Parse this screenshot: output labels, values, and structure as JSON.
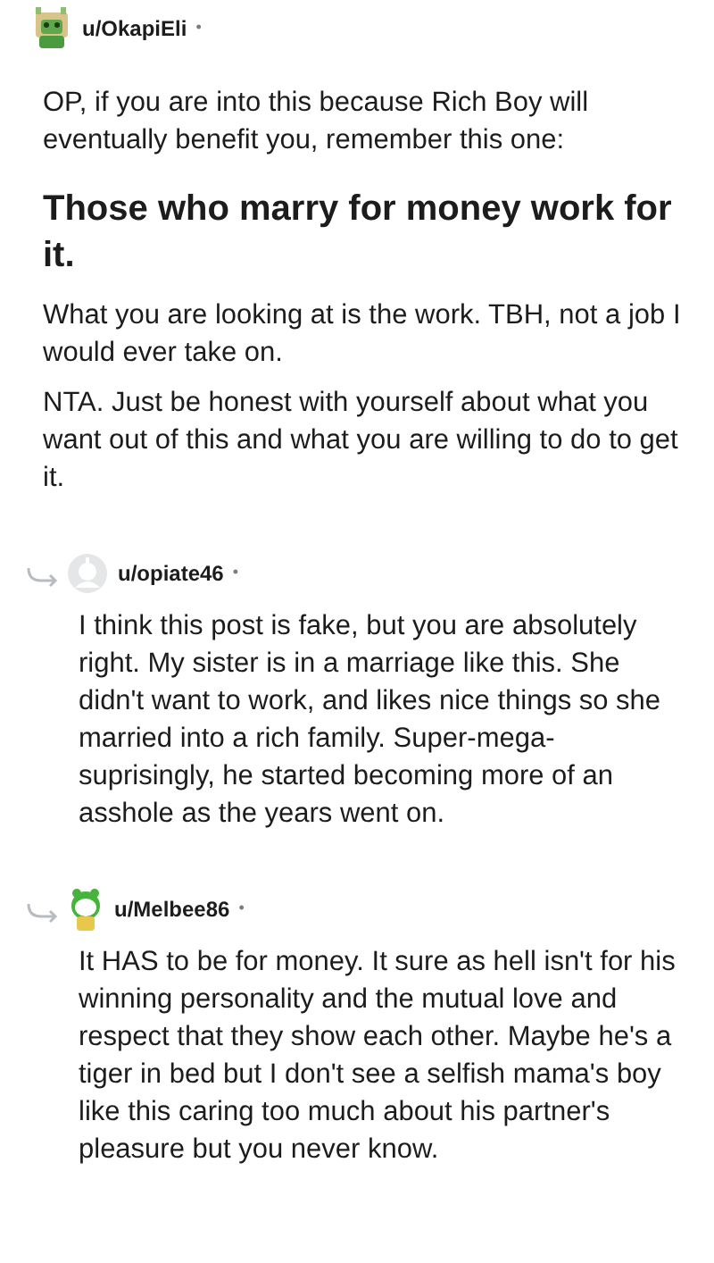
{
  "comments": [
    {
      "author": "u/OkapiEli",
      "separator": "•",
      "is_reply": false,
      "paragraphs": [
        {
          "kind": "text",
          "text": "OP, if you are into this because Rich Boy will eventually benefit you, remember this one:"
        },
        {
          "kind": "heading",
          "text": "Those who marry for money work for it."
        },
        {
          "kind": "text",
          "text": "What you are looking at is the work. TBH, not a job I would ever take on."
        },
        {
          "kind": "text",
          "text": "NTA. Just be honest with yourself about what you want out of this and what you are willing to do to get it."
        }
      ]
    },
    {
      "author": "u/opiate46",
      "separator": "•",
      "is_reply": true,
      "paragraphs": [
        {
          "kind": "text",
          "text": "I think this post is fake, but you are absolutely right. My sister is in a marriage like this. She didn't want to work, and likes nice things so she married into a rich family. Super-mega-suprisingly, he started becoming more of an asshole as the years went on."
        }
      ]
    },
    {
      "author": "u/Melbee86",
      "separator": "•",
      "is_reply": true,
      "paragraphs": [
        {
          "kind": "text",
          "text": "It HAS to be for money. It sure as hell isn't for his winning personality and the mutual love and respect that they show each other. Maybe he's a tiger in bed but I don't see a selfish mama's boy like this caring too much about his partner's pleasure but you never know."
        }
      ]
    }
  ]
}
